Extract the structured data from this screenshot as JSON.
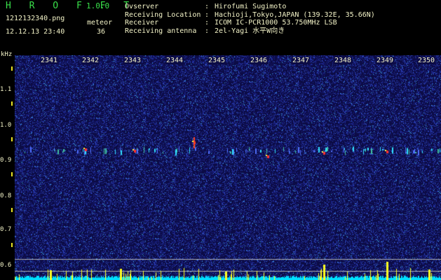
{
  "header": {
    "brand": "H R O F F T",
    "version": "1.0.0",
    "filename": "1212132340.png",
    "datetime": "12.12.13 23:40",
    "mode_label": "meteor",
    "mode_value": "36"
  },
  "info": [
    {
      "label": "Ovserver",
      "value": "Hirofumi Sugimoto"
    },
    {
      "label": "Receiving Location",
      "value": "Hachioji,Tokyo,JAPAN (139.32E, 35.66N)"
    },
    {
      "label": "Receiver",
      "value": "ICOM IC-PCR1000 53.750MHz LSB"
    },
    {
      "label": "Receiving antenna",
      "value": "2el-Yagi 水平W向き"
    }
  ],
  "spectrogram": {
    "y_unit": "kHz",
    "y_ticks": [
      "1.1",
      "1.0",
      "0.9",
      "0.8",
      "0.7",
      "0.6"
    ],
    "x_ticks": [
      "2341",
      "2342",
      "2343",
      "2344",
      "2345",
      "2346",
      "2347",
      "2348",
      "2349",
      "2350"
    ],
    "colors": {
      "background": "#0c0c46",
      "trace": "#00e0ff",
      "peaks": "#ffff20",
      "guide_line": "#b0b0b0"
    }
  }
}
